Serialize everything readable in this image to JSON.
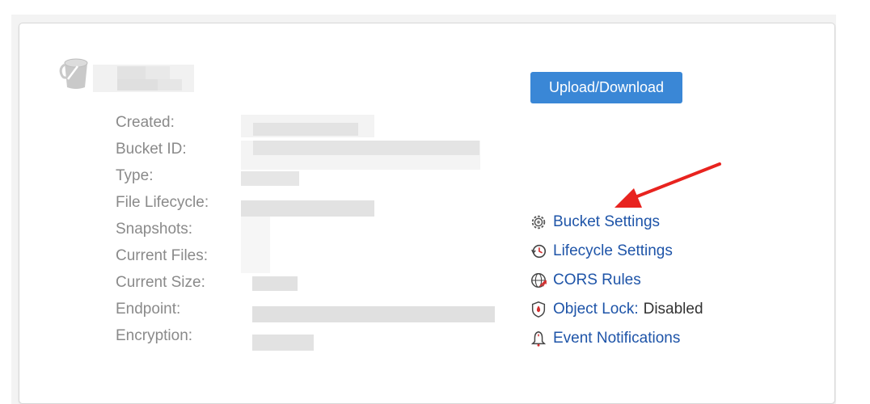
{
  "bucket": {
    "icon": "bucket-icon",
    "name_redacted": true
  },
  "details": {
    "labels": [
      "Created:",
      "Bucket ID:",
      "Type:",
      "File Lifecycle:",
      "Snapshots:",
      "Current Files:",
      "Current Size:",
      "Endpoint:",
      "Encryption:"
    ],
    "values_redacted": true
  },
  "actions": {
    "upload_download_label": "Upload/Download",
    "bucket_settings_label": "Bucket Settings",
    "lifecycle_settings_label": "Lifecycle Settings",
    "cors_rules_label": "CORS Rules",
    "object_lock_label": "Object Lock:",
    "object_lock_status": "Disabled",
    "event_notifications_label": "Event Notifications"
  },
  "colors": {
    "link": "#1e54a8",
    "button": "#3a87d6",
    "label": "#8a8a8a",
    "annotation_arrow": "#e8231f"
  }
}
